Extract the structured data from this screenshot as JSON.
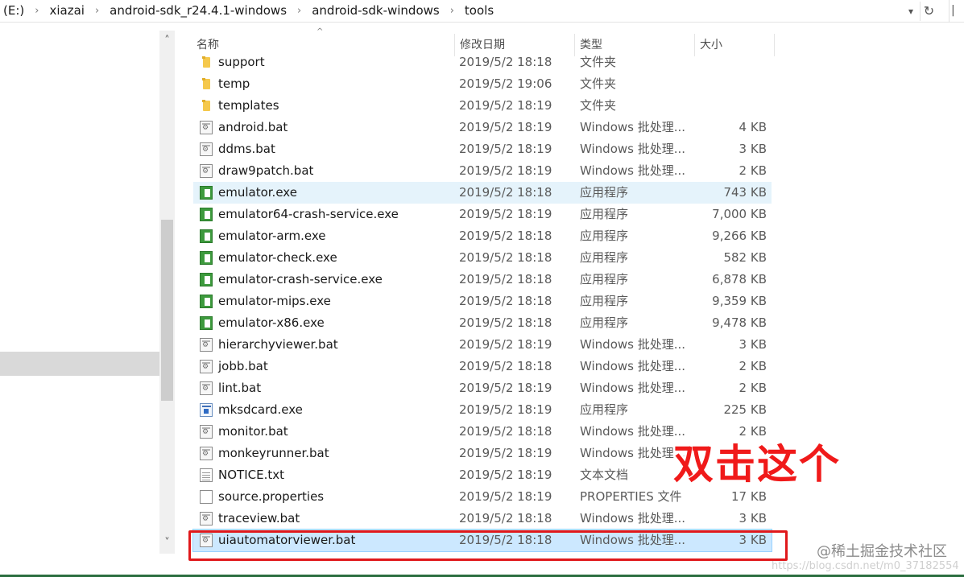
{
  "address_bar": {
    "crumbs": [
      "(E:)",
      "xiazai",
      "android-sdk_r24.4.1-windows",
      "android-sdk-windows",
      "tools"
    ],
    "separator": "›",
    "dropdown_icon": "chevron-down-icon",
    "refresh_icon": "refresh-icon"
  },
  "columns": {
    "name": "名称",
    "modified": "修改日期",
    "type": "类型",
    "size": "大小"
  },
  "files": [
    {
      "name": "support",
      "date": "2019/5/2 18:18",
      "type": "文件夹",
      "size": "",
      "icon": "folder"
    },
    {
      "name": "temp",
      "date": "2019/5/2 19:06",
      "type": "文件夹",
      "size": "",
      "icon": "folder"
    },
    {
      "name": "templates",
      "date": "2019/5/2 18:19",
      "type": "文件夹",
      "size": "",
      "icon": "folder"
    },
    {
      "name": "android.bat",
      "date": "2019/5/2 18:19",
      "type": "Windows 批处理...",
      "size": "4 KB",
      "icon": "bat"
    },
    {
      "name": "ddms.bat",
      "date": "2019/5/2 18:19",
      "type": "Windows 批处理...",
      "size": "3 KB",
      "icon": "bat"
    },
    {
      "name": "draw9patch.bat",
      "date": "2019/5/2 18:19",
      "type": "Windows 批处理...",
      "size": "2 KB",
      "icon": "bat"
    },
    {
      "name": "emulator.exe",
      "date": "2019/5/2 18:18",
      "type": "应用程序",
      "size": "743 KB",
      "icon": "exe"
    },
    {
      "name": "emulator64-crash-service.exe",
      "date": "2019/5/2 18:19",
      "type": "应用程序",
      "size": "7,000 KB",
      "icon": "exe"
    },
    {
      "name": "emulator-arm.exe",
      "date": "2019/5/2 18:18",
      "type": "应用程序",
      "size": "9,266 KB",
      "icon": "exe"
    },
    {
      "name": "emulator-check.exe",
      "date": "2019/5/2 18:18",
      "type": "应用程序",
      "size": "582 KB",
      "icon": "exe"
    },
    {
      "name": "emulator-crash-service.exe",
      "date": "2019/5/2 18:18",
      "type": "应用程序",
      "size": "6,878 KB",
      "icon": "exe"
    },
    {
      "name": "emulator-mips.exe",
      "date": "2019/5/2 18:18",
      "type": "应用程序",
      "size": "9,359 KB",
      "icon": "exe"
    },
    {
      "name": "emulator-x86.exe",
      "date": "2019/5/2 18:18",
      "type": "应用程序",
      "size": "9,478 KB",
      "icon": "exe"
    },
    {
      "name": "hierarchyviewer.bat",
      "date": "2019/5/2 18:19",
      "type": "Windows 批处理...",
      "size": "3 KB",
      "icon": "bat"
    },
    {
      "name": "jobb.bat",
      "date": "2019/5/2 18:18",
      "type": "Windows 批处理...",
      "size": "2 KB",
      "icon": "bat"
    },
    {
      "name": "lint.bat",
      "date": "2019/5/2 18:19",
      "type": "Windows 批处理...",
      "size": "2 KB",
      "icon": "bat"
    },
    {
      "name": "mksdcard.exe",
      "date": "2019/5/2 18:19",
      "type": "应用程序",
      "size": "225 KB",
      "icon": "mks"
    },
    {
      "name": "monitor.bat",
      "date": "2019/5/2 18:18",
      "type": "Windows 批处理...",
      "size": "2 KB",
      "icon": "bat"
    },
    {
      "name": "monkeyrunner.bat",
      "date": "2019/5/2 18:19",
      "type": "Windows 批处理...",
      "size": "",
      "icon": "bat"
    },
    {
      "name": "NOTICE.txt",
      "date": "2019/5/2 18:19",
      "type": "文本文档",
      "size": "",
      "icon": "txt"
    },
    {
      "name": "source.properties",
      "date": "2019/5/2 18:19",
      "type": "PROPERTIES 文件",
      "size": "17 KB",
      "icon": "blank"
    },
    {
      "name": "traceview.bat",
      "date": "2019/5/2 18:18",
      "type": "Windows 批处理...",
      "size": "3 KB",
      "icon": "bat"
    },
    {
      "name": "uiautomatorviewer.bat",
      "date": "2019/5/2 18:18",
      "type": "Windows 批处理...",
      "size": "3 KB",
      "icon": "bat"
    }
  ],
  "hover_row": "emulator.exe",
  "selected_row": "uiautomatorviewer.bat",
  "annotation": {
    "text": "双击这个",
    "color": "#f01a1a"
  },
  "watermark": {
    "main": "@稀土掘金技术社区",
    "faint": "https://blog.csdn.net/m0_37182554"
  }
}
